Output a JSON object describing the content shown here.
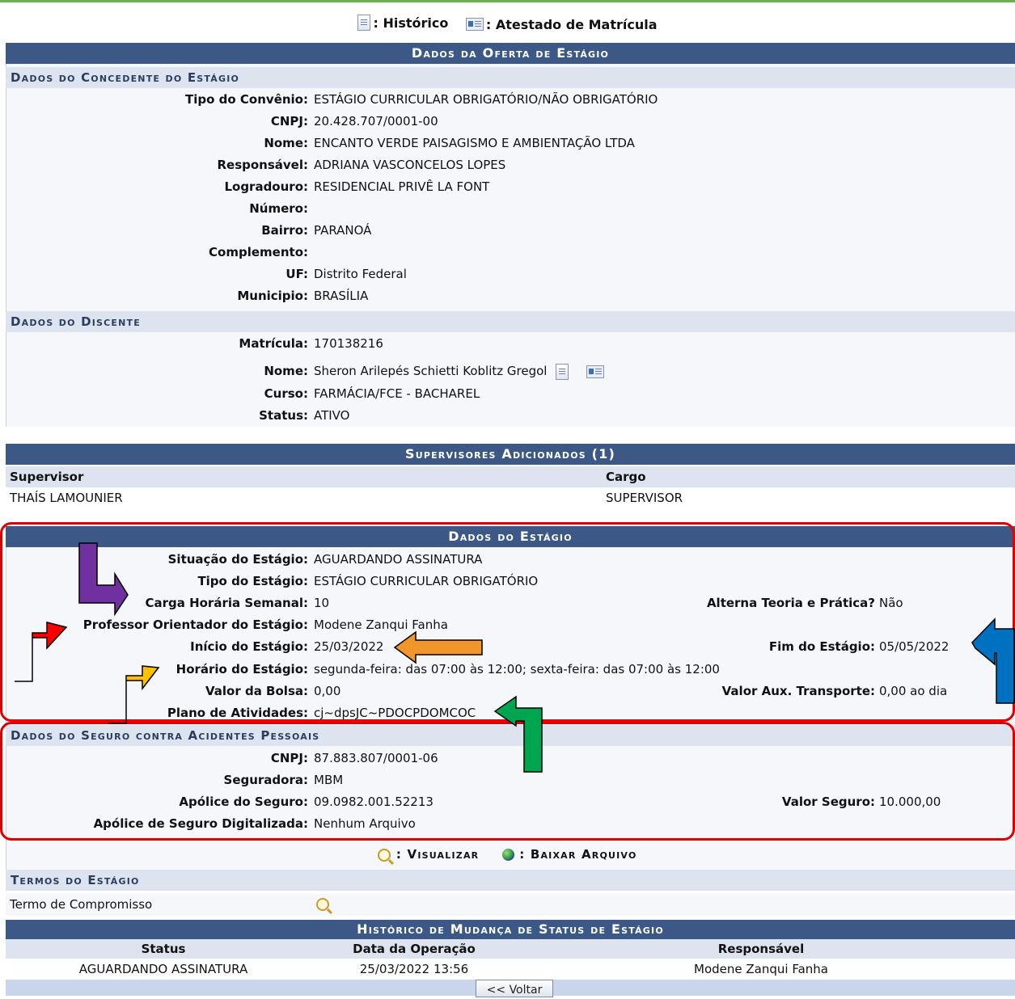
{
  "legend": {
    "historico": ": Histórico",
    "atestado": ": Atestado de Matrícula"
  },
  "oferta": {
    "title": "Dados da Oferta de Estágio",
    "concedente": {
      "title": "Dados do Concedente do Estágio",
      "fields": [
        {
          "label": "Tipo do Convênio:",
          "value": "ESTÁGIO CURRICULAR OBRIGATÓRIO/NÃO OBRIGATÓRIO"
        },
        {
          "label": "CNPJ:",
          "value": "20.428.707/0001-00"
        },
        {
          "label": "Nome:",
          "value": "ENCANTO VERDE PAISAGISMO E AMBIENTAÇÃO LTDA"
        },
        {
          "label": "Responsável:",
          "value": "ADRIANA VASCONCELOS LOPES"
        },
        {
          "label": "Logradouro:",
          "value": "RESIDENCIAL PRIVÊ LA FONT"
        },
        {
          "label": "Número:",
          "value": ""
        },
        {
          "label": "Bairro:",
          "value": "PARANOÁ"
        },
        {
          "label": "Complemento:",
          "value": ""
        },
        {
          "label": "UF:",
          "value": "Distrito Federal"
        },
        {
          "label": "Municipio:",
          "value": "BRASÍLIA"
        }
      ]
    },
    "discente": {
      "title": "Dados do Discente",
      "fields": [
        {
          "label": "Matrícula:",
          "value": "170138216"
        },
        {
          "label": "Nome:",
          "value": "Sheron Arilepés Schietti Koblitz Gregol"
        },
        {
          "label": "Curso:",
          "value": "FARMÁCIA/FCE - BACHAREL"
        },
        {
          "label": "Status:",
          "value": "ATIVO"
        }
      ]
    }
  },
  "supervisores": {
    "title": "Supervisores Adicionados (1)",
    "columns": [
      "Supervisor",
      "Cargo"
    ],
    "rows": [
      [
        "THAÍS LAMOUNIER",
        "SUPERVISOR"
      ]
    ]
  },
  "estagio": {
    "title": "Dados do Estágio",
    "situacao": {
      "label": "Situação do Estágio:",
      "value": "AGUARDANDO ASSINATURA"
    },
    "tipo": {
      "label": "Tipo do Estágio:",
      "value": "ESTÁGIO CURRICULAR OBRIGATÓRIO"
    },
    "carga": {
      "label": "Carga Horária Semanal:",
      "value": "10"
    },
    "alterna": {
      "label": "Alterna Teoria e Prática?",
      "value": "Não"
    },
    "professor": {
      "label": "Professor Orientador do Estágio:",
      "value": "Modene Zanqui Fanha"
    },
    "inicio": {
      "label": "Início do Estágio:",
      "value": "25/03/2022"
    },
    "fim": {
      "label": "Fim do Estágio:",
      "value": "05/05/2022"
    },
    "horario": {
      "label": "Horário do Estágio:",
      "value": "segunda-feira: das 07:00 às 12:00; sexta-feira: das 07:00 às 12:00"
    },
    "bolsa": {
      "label": "Valor da Bolsa:",
      "value": "0,00"
    },
    "transporte": {
      "label": "Valor Aux. Transporte:",
      "value": "0,00 ao dia"
    },
    "plano": {
      "label": "Plano de Atividades:",
      "value": "cj~dpsJC~PDOCPDOMCOC"
    }
  },
  "seguro": {
    "title": "Dados do Seguro contra Acidentes Pessoais",
    "cnpj": {
      "label": "CNPJ:",
      "value": "87.883.807/0001-06"
    },
    "seguradora": {
      "label": "Seguradora:",
      "value": "MBM"
    },
    "apolice": {
      "label": "Apólice do Seguro:",
      "value": "09.0982.001.52213"
    },
    "valor": {
      "label": "Valor Seguro:",
      "value": "10.000,00"
    },
    "digitalizada": {
      "label": "Apólice de Seguro Digitalizada:",
      "value": "Nenhum Arquivo"
    }
  },
  "legend2": {
    "visualizar": ": Visualizar",
    "baixar": ": Baixar Arquivo"
  },
  "termos": {
    "title": "Termos do Estágio",
    "item": "Termo de Compromisso"
  },
  "historico": {
    "title": "Histórico de Mudança de Status de Estágio",
    "columns": [
      "Status",
      "Data da Operação",
      "Responsável"
    ],
    "rows": [
      [
        "AGUARDANDO ASSINATURA",
        "25/03/2022 13:56",
        "Modene Zanqui Fanha"
      ]
    ]
  },
  "voltar": "<< Voltar",
  "colors": {
    "header": "#3c5887",
    "subheader": "#dde4ef",
    "panel": "#f5f7fb",
    "annotation_red": "#e00000",
    "purple": "#7030a0",
    "arrow_red": "#ff0000",
    "orange": "#f0962a",
    "yellow": "#ffc000",
    "green": "#00a550",
    "blue": "#0070c0"
  }
}
